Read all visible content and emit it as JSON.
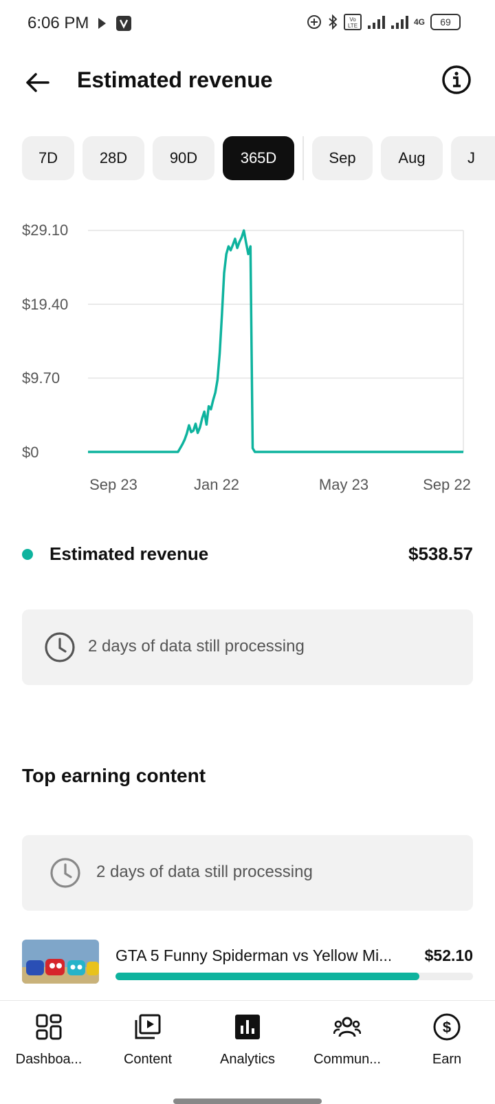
{
  "status_bar": {
    "time": "6:06 PM",
    "battery": "69",
    "network": "4G"
  },
  "header": {
    "title": "Estimated revenue"
  },
  "chips": [
    {
      "label": "7D",
      "active": false
    },
    {
      "label": "28D",
      "active": false
    },
    {
      "label": "90D",
      "active": false
    },
    {
      "label": "365D",
      "active": true
    },
    {
      "label": "Sep",
      "active": false
    },
    {
      "label": "Aug",
      "active": false
    },
    {
      "label": "J",
      "active": false
    }
  ],
  "chart_data": {
    "type": "line",
    "y_ticks": [
      "$29.10",
      "$19.40",
      "$9.70",
      "$0"
    ],
    "x_ticks": [
      "Sep 23",
      "Jan 22",
      "May 23",
      "Sep 22"
    ],
    "ylim": [
      0,
      29.1
    ],
    "grid": true,
    "series": [
      {
        "color": "#0eb39e",
        "values": [
          0,
          0,
          0,
          0,
          0,
          0,
          0,
          0,
          0,
          0,
          0,
          0,
          0,
          0,
          0,
          0,
          0,
          0,
          0,
          0,
          0,
          0,
          0,
          0,
          0,
          0,
          0,
          0,
          0,
          0,
          0,
          0,
          0,
          0,
          0,
          0,
          0,
          0,
          0,
          0,
          0,
          0,
          0.5,
          1.0,
          1.6,
          2.4,
          3.5,
          2.6,
          2.8,
          3.7,
          2.5,
          3.2,
          4.4,
          5.3,
          3.6,
          6.0,
          5.6,
          6.8,
          7.8,
          9.5,
          13.0,
          18.0,
          23.5,
          26.0,
          27.0,
          26.5,
          27.2,
          28.0,
          26.8,
          27.6,
          28.2,
          29.1,
          27.5,
          26.0,
          27.0,
          0.5,
          0,
          0,
          0,
          0,
          0,
          0,
          0,
          0,
          0,
          0,
          0,
          0,
          0,
          0,
          0,
          0,
          0,
          0,
          0,
          0,
          0,
          0,
          0,
          0,
          0,
          0,
          0,
          0,
          0,
          0,
          0,
          0,
          0,
          0,
          0,
          0,
          0,
          0,
          0,
          0,
          0,
          0,
          0,
          0,
          0,
          0,
          0,
          0,
          0,
          0,
          0,
          0,
          0,
          0,
          0,
          0,
          0,
          0,
          0,
          0,
          0,
          0,
          0,
          0,
          0,
          0,
          0,
          0,
          0,
          0,
          0,
          0,
          0,
          0,
          0,
          0,
          0,
          0,
          0,
          0,
          0,
          0,
          0,
          0,
          0,
          0,
          0,
          0,
          0,
          0,
          0,
          0,
          0,
          0,
          0,
          0
        ]
      }
    ]
  },
  "legend": {
    "label": "Estimated revenue",
    "value": "$538.57",
    "color": "#0eb39e"
  },
  "processing_notice": "2 days of data still processing",
  "top_earning": {
    "title": "Top earning content",
    "notice": "2 days of data still processing",
    "items": [
      {
        "title": "GTA 5 Funny Spiderman vs Yellow Mi...",
        "value": "$52.10",
        "share": 0.85
      }
    ]
  },
  "bottom_nav": [
    {
      "label": "Dashboa...",
      "icon": "dashboard-icon"
    },
    {
      "label": "Content",
      "icon": "content-icon"
    },
    {
      "label": "Analytics",
      "icon": "analytics-icon"
    },
    {
      "label": "Commun...",
      "icon": "community-icon"
    },
    {
      "label": "Earn",
      "icon": "earn-icon"
    }
  ]
}
